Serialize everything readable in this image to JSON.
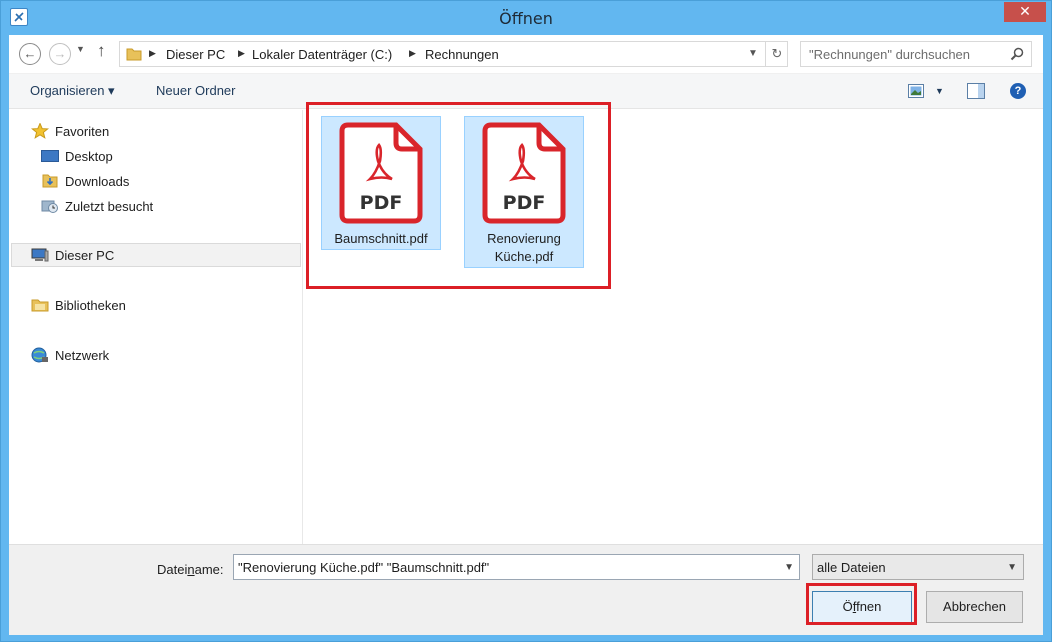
{
  "window": {
    "title": "Öffnen",
    "close_glyph": "✕"
  },
  "address_bar": {
    "crumbs": [
      "Dieser PC",
      "Lokaler Datenträger (C:)",
      "Rechnungen"
    ],
    "back_glyph": "←",
    "forward_glyph": "→",
    "up_glyph": "↑",
    "refresh_glyph": "↻"
  },
  "search": {
    "placeholder": "\"Rechnungen\" durchsuchen"
  },
  "toolbar": {
    "organize_label": "Organisieren ▾",
    "new_folder_label": "Neuer Ordner",
    "help_glyph": "?"
  },
  "nav_pane": {
    "favorites": "Favoriten",
    "favorites_items": [
      "Desktop",
      "Downloads",
      "Zuletzt besucht"
    ],
    "this_pc": "Dieser PC",
    "libraries": "Bibliotheken",
    "network": "Netzwerk"
  },
  "files": [
    {
      "name": "Baumschnitt.pdf",
      "icon_text": "PDF"
    },
    {
      "name": "Renovierung Küche.pdf",
      "name_line1": "Renovierung",
      "name_line2": "Küche.pdf",
      "icon_text": "PDF"
    }
  ],
  "bottom": {
    "filename_label_pre": "Datei",
    "filename_label_u": "n",
    "filename_label_post": "ame:",
    "filename_value": "\"Renovierung Küche.pdf\" \"Baumschnitt.pdf\"",
    "filetype_value": "alle Dateien",
    "open_pre": "Ö",
    "open_u": "f",
    "open_post": "fnen",
    "cancel_label": "Abbrechen"
  },
  "colors": {
    "titlebar": "#62b7f0",
    "selection": "#cce8ff",
    "annotation": "#dc1f26",
    "pdf_red": "#d9252b"
  }
}
